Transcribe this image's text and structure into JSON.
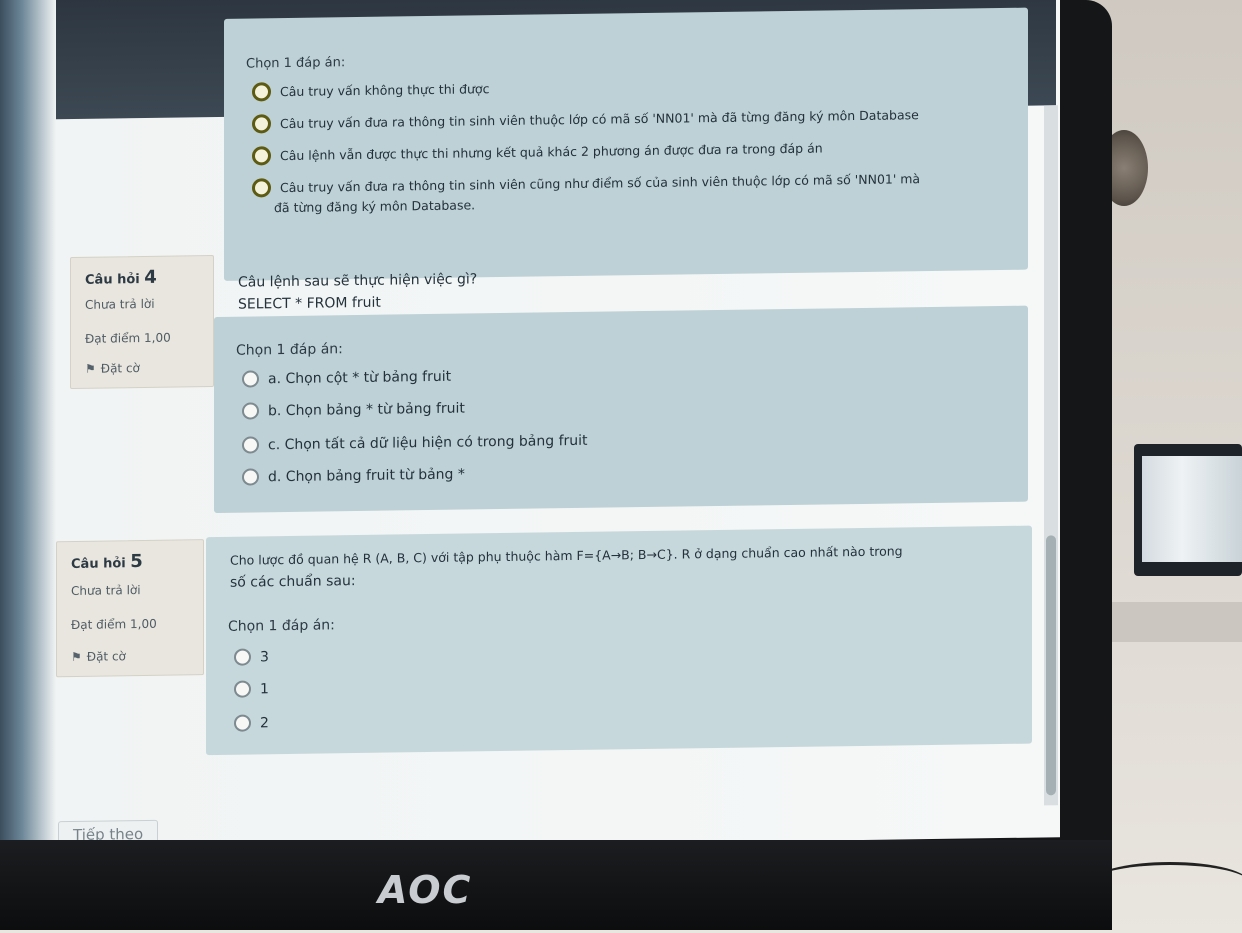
{
  "monitor": {
    "brand": "AOC"
  },
  "question3": {
    "prompt": "Chọn 1 đáp án:",
    "options": [
      "Câu truy vấn không thực thi được",
      "Câu truy vấn đưa ra thông tin sinh viên thuộc lớp có mã số 'NN01' mà đã từng đăng ký môn Database",
      "Câu lệnh vẫn được thực thi nhưng kết quả khác 2 phương án được đưa ra trong đáp án",
      "Câu truy vấn đưa ra thông tin sinh viên cũng như điểm số của sinh viên thuộc lớp có mã số 'NN01' mà",
      "đã từng đăng ký môn Database."
    ]
  },
  "question4": {
    "label": "Câu hỏi",
    "number": "4",
    "status": "Chưa trả lời",
    "points": "Đạt điểm 1,00",
    "flag_label": "Đặt cờ",
    "text_line1": "Câu lệnh sau sẽ thực hiện việc gì?",
    "text_line2": "SELECT * FROM fruit",
    "prompt": "Chọn 1 đáp án:",
    "options": [
      "a. Chọn cột * từ bảng fruit",
      "b. Chọn bảng * từ bảng fruit",
      "c. Chọn tất cả dữ liệu hiện có trong bảng fruit",
      "d. Chọn bảng fruit từ bảng *"
    ]
  },
  "question5": {
    "label": "Câu hỏi",
    "number": "5",
    "status": "Chưa trả lời",
    "points": "Đạt điểm 1,00",
    "flag_label": "Đặt cờ",
    "text_line1": "Cho lược đồ quan hệ R (A, B, C) với tập phụ thuộc hàm F={A→B; B→C}. R ở dạng chuẩn cao nhất nào trong",
    "text_line2": "số các chuẩn sau:",
    "prompt": "Chọn 1 đáp án:",
    "options": [
      "3",
      "1",
      "2"
    ]
  },
  "navigation": {
    "next_label": "Tiếp theo"
  }
}
